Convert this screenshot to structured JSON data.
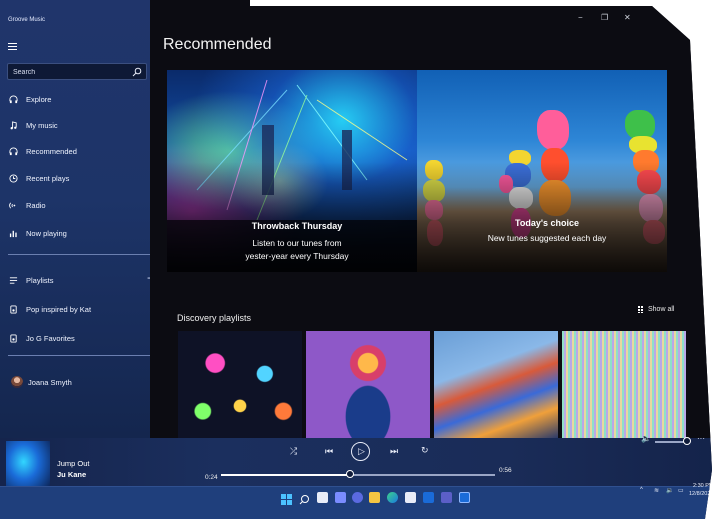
{
  "window": {
    "app_title": "Groove Music",
    "minimize_glyph": "−",
    "maximize_glyph": "❐",
    "close_glyph": "✕"
  },
  "sidebar": {
    "search_placeholder": "Search",
    "items": [
      {
        "label": "Explore",
        "icon": "headphones-icon"
      },
      {
        "label": "My music",
        "icon": "music-note-icon"
      },
      {
        "label": "Recommended",
        "icon": "headphones-icon"
      },
      {
        "label": "Recent plays",
        "icon": "clock-icon"
      },
      {
        "label": "Radio",
        "icon": "radio-icon"
      },
      {
        "label": "Now playing",
        "icon": "bars-icon"
      }
    ],
    "playlists_header": "Playlists",
    "add_glyph": "+",
    "playlists": [
      {
        "label": "Pop inspired by Kat",
        "icon": "playlist-icon"
      },
      {
        "label": "Jo G Favorites",
        "icon": "playlist-icon"
      }
    ],
    "user": {
      "name": "Joana Smyth"
    }
  },
  "main": {
    "title": "Recommended",
    "hero": [
      {
        "title": "Throwback Thursday",
        "subtitle_line1": "Listen to our tunes from",
        "subtitle_line2": "yester-year every Thursday"
      },
      {
        "title": "Today's choice",
        "subtitle_line1": "New tunes suggested each day",
        "subtitle_line2": ""
      }
    ],
    "discovery": {
      "title": "Discovery playlists",
      "show_all": "Show all"
    }
  },
  "player": {
    "track_title": "Jump Out",
    "artist": "Ju Kane",
    "elapsed": "0:24",
    "duration": "0:56",
    "progress": 0.47,
    "volume": 0.9,
    "controls": {
      "shuffle": "⤮",
      "previous": "⏮",
      "play": "▷",
      "next": "⏭",
      "repeat": "↻",
      "volume": "🔈",
      "more": "···"
    }
  },
  "taskbar": {
    "time": "2:30 PM",
    "date": "12/8/2021",
    "tray_chevron": "^"
  },
  "colors": {
    "sidebar": "#1d3468",
    "main_bg": "#0c0c12",
    "player": "#1b2f5e",
    "taskbar": "#1f3f7c"
  }
}
